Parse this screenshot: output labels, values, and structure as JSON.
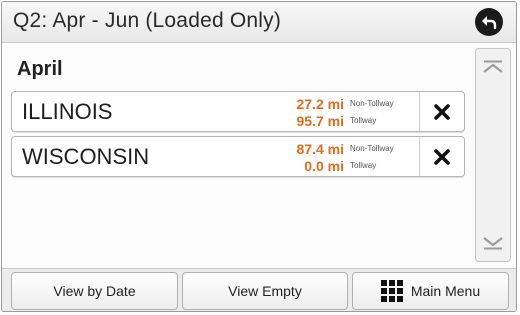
{
  "header": {
    "title": "Q2: Apr - Jun (Loaded Only)",
    "back_icon": "back-arrow-icon"
  },
  "section": {
    "month": "April"
  },
  "rows": [
    {
      "state": "ILLINOIS",
      "miles": [
        {
          "value": "27.2 mi",
          "label": "Non-Tollway"
        },
        {
          "value": "95.7 mi",
          "label": "Tollway"
        }
      ],
      "delete_icon": "close-icon"
    },
    {
      "state": "WISCONSIN",
      "miles": [
        {
          "value": "87.4 mi",
          "label": "Non-Tollway"
        },
        {
          "value": "0.0 mi",
          "label": "Tollway"
        }
      ],
      "delete_icon": "close-icon"
    }
  ],
  "scroll": {
    "up_icon": "scroll-up-icon",
    "down_icon": "scroll-down-icon"
  },
  "footer": {
    "view_by_date": "View by Date",
    "view_empty": "View Empty",
    "main_menu": "Main Menu",
    "main_menu_icon": "grid-menu-icon"
  },
  "colors": {
    "miles": "#e46a1d",
    "back_button": "#1a1a1a"
  }
}
